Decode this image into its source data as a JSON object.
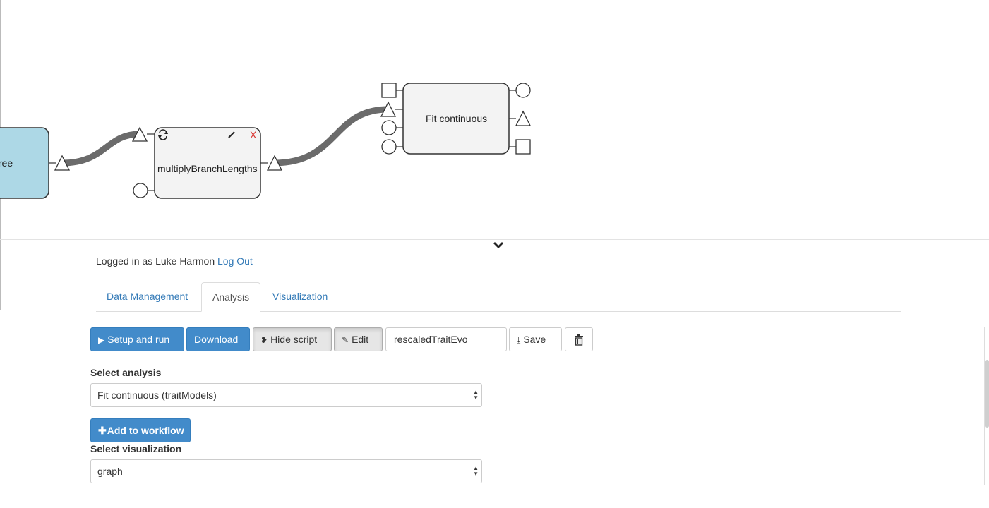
{
  "workflow": {
    "nodes": {
      "tree": {
        "label": "tree"
      },
      "multiply": {
        "label": "multiplyBranchLengths",
        "edit_icon": "pencil-icon",
        "remove_icon": "x-icon",
        "remove_glyph": "X",
        "refresh_icon": "refresh-icon"
      },
      "fit": {
        "label": "Fit continuous"
      }
    },
    "colors": {
      "tree_node": "#add8e6",
      "node_fill": "#f3f3f3",
      "connection": "#6b6b6b",
      "remove": "#d9302c"
    }
  },
  "collapse_icon": "chevron-down-icon",
  "auth": {
    "prefix": "Logged in as Luke Harmon",
    "logout": "Log Out"
  },
  "tabs": [
    {
      "label": "Data Management",
      "active": false
    },
    {
      "label": "Analysis",
      "active": true
    },
    {
      "label": "Visualization",
      "active": false
    }
  ],
  "toolbar": {
    "setup_run": "Setup and run",
    "download": "Download",
    "hide_script": "Hide script",
    "edit": "Edit",
    "name_value": "rescaledTraitEvo",
    "save": "Save",
    "delete_icon": "trash-icon"
  },
  "analysis": {
    "label": "Select analysis",
    "selected": "Fit continuous (traitModels)",
    "add_button": "Add to workflow"
  },
  "visualization": {
    "label": "Select visualization",
    "selected": "graph"
  }
}
